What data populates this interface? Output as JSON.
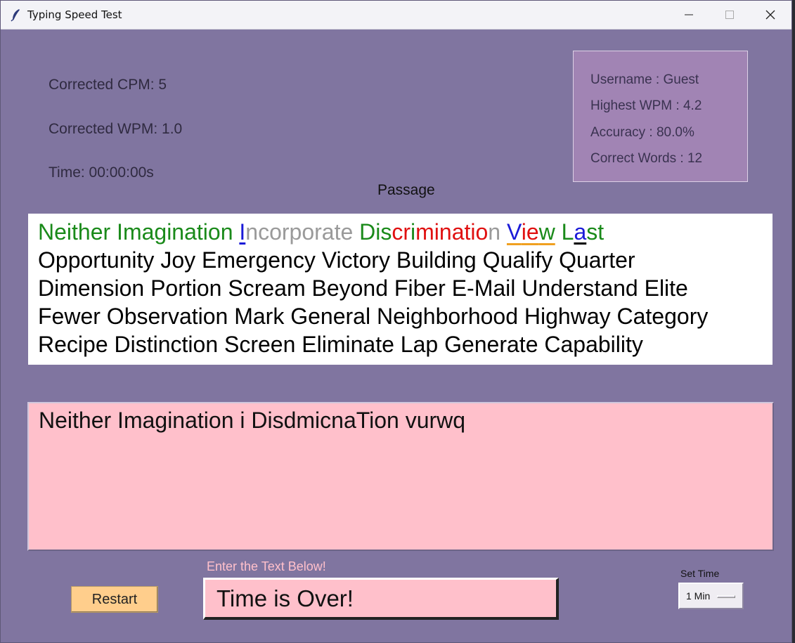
{
  "window": {
    "title": "Typing Speed Test"
  },
  "stats": {
    "cpm": "Corrected CPM: 5",
    "wpm": "Corrected WPM: 1.0",
    "time": "Time: 00:00:00s"
  },
  "info": {
    "username": "Username : Guest",
    "highest_wpm": "Highest WPM : 4.2",
    "accuracy": "Accuracy : 80.0%",
    "correct_words": "Correct Words : 12"
  },
  "passage": {
    "label": "Passage",
    "w1": "Neither",
    "w2": "Imagination",
    "w3_a": "I",
    "w3_b": "ncorporate",
    "w4_a": "Dis",
    "w4_b": "cr",
    "w4_c": "i",
    "w4_d": "minatio",
    "w4_e": "n",
    "w5_a": "V",
    "w5_b": "ie",
    "w5_c": "w",
    "w6_a": "L",
    "w6_b": "a",
    "w6_c": "st",
    "line2": "Opportunity Joy Emergency Victory Building Qualify Quarter",
    "line3": "Dimension Portion Scream Beyond Fiber E-Mail Understand Elite",
    "line4": "Fewer Observation Mark General Neighborhood Highway Category",
    "line5": "Recipe Distinction Screen Eliminate Lap Generate Capability"
  },
  "typed_text": "Neither Imagination i DisdmicnaTion vurwq",
  "entry": {
    "label": "Enter the Text Below!",
    "value": "Time is Over!"
  },
  "buttons": {
    "restart": "Restart"
  },
  "set_time": {
    "label": "Set Time",
    "selected": "1 Min"
  },
  "colors": {
    "background": "#8075a0",
    "info_box": "#a184b4",
    "pink": "#ffc0cb",
    "restart": "#ffce8c",
    "correct": "#1a8a1a",
    "wrong": "#e01010",
    "skipped": "#9a9a9a",
    "current": "#1a1ad8"
  }
}
